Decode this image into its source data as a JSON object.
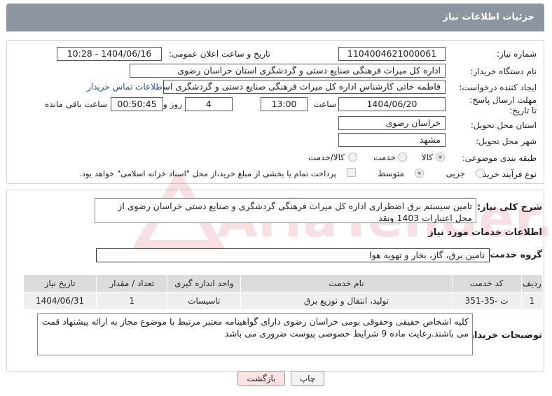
{
  "header": {
    "title": "جزئیات اطلاعات نیاز"
  },
  "form": {
    "need_number_label": "شماره نیاز:",
    "need_number": "1104004621000061",
    "announce_label": "تاریخ و ساعت اعلان عمومی:",
    "announce_value": "1404/06/16 - 10:28",
    "buyer_label": "نام دستگاه خریدار:",
    "buyer_value": "اداره کل میراث فرهنگی  صنایع دستی و گردشگری استان خراسان رضوی",
    "creator_label": "ایجاد کننده درخواست:",
    "creator_value": "فاطمه خاتی کارشناس اداره کل میراث فرهنگی  صنایع دستی و گردشگری استان",
    "contact_link": "اطلاعات تماس خریدار",
    "deadline_label": "مهلت ارسال پاسخ: تا تاریخ:",
    "deadline_date": "1404/06/20",
    "time_label": "ساعت",
    "deadline_time": "13:00",
    "days_value": "4",
    "days_label": "روز و",
    "remaining_value": "00:50:45",
    "remaining_label": "ساعت باقی مانده",
    "province_label": "استان محل تحویل:",
    "province_value": "خراسان رضوی",
    "city_label": "شهر محل تحویل:",
    "city_value": "مشهد",
    "category_label": "طبقه بندی موضوعی:",
    "category_options": [
      "کالا",
      "خدمت",
      "کالا/خدمت"
    ],
    "process_label": "نوع فرآیند خرید :",
    "process_options": [
      "جزیی",
      "متوسط"
    ],
    "payment_note": "پرداخت تمام یا بخشی از مبلغ خرید،از محل \"اسناد خزانه اسلامی\" خواهد بود."
  },
  "summary": {
    "label": "شرح کلی نیاز:",
    "text": "تامین سیستم برق اضطراری اداره کل میراث فرهنگی گردشگری و صنایع دستی خراسان رضوی از محل اعتبارات 1403 ونقد"
  },
  "services": {
    "section_title": "اطلاعات خدمات مورد نیاز",
    "group_label": "گروه خدمت:",
    "group_value": "تامین برق، گاز، بخار و تهویه هوا",
    "columns": [
      "ردیف",
      "کد خدمت",
      "نام خدمت",
      "واحد اندازه گیری",
      "تعداد / مقدار",
      "تاریخ نیاز"
    ],
    "rows": [
      [
        "1",
        "ت -35-351",
        "تولید، انتقال و توزیع برق",
        "تاسیسات",
        "1",
        "1404/06/31"
      ]
    ]
  },
  "buyer_notes": {
    "label": "توضیحات خریدار:",
    "text": "کلیه اشخاص حقیقی وحقوقی بومی خراسان رضوی دارای گواهینامه معتبر مرتبط با موضوع  مجاز به ارائه پیشنهاد قمت می باشند.رعایت ماده 9 شرایط خصوصی پیوست ضروری می باشد"
  },
  "buttons": {
    "print": "چاپ",
    "back": "بازگشت"
  },
  "watermark": {
    "text": "AriaTender.neT"
  },
  "colors": {
    "titlebar": "#8d96a0",
    "back_button": "#fbe3e3",
    "link": "#1a4fb5"
  }
}
